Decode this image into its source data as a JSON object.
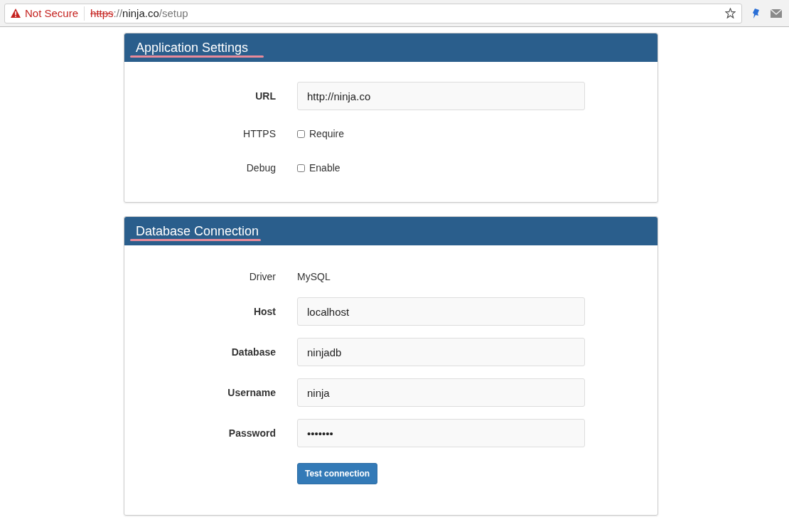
{
  "browser": {
    "security": "Not Secure",
    "url": {
      "scheme": "https",
      "separator": "://",
      "host": "ninja.co",
      "path": "/setup"
    }
  },
  "panels": [
    {
      "title": "Application Settings",
      "fields": [
        {
          "kind": "text",
          "label": "URL",
          "value": "http://ninja.co"
        },
        {
          "kind": "checkbox",
          "label": "HTTPS",
          "option": "Require",
          "checked": false
        },
        {
          "kind": "checkbox",
          "label": "Debug",
          "option": "Enable",
          "checked": false
        }
      ]
    },
    {
      "title": "Database Connection",
      "fields": [
        {
          "kind": "static",
          "label": "Driver",
          "value": "MySQL"
        },
        {
          "kind": "text",
          "label": "Host",
          "value": "localhost"
        },
        {
          "kind": "text",
          "label": "Database",
          "value": "ninjadb"
        },
        {
          "kind": "text",
          "label": "Username",
          "value": "ninja"
        },
        {
          "kind": "password",
          "label": "Password",
          "value": "•••••••"
        }
      ],
      "button": "Test connection"
    }
  ]
}
